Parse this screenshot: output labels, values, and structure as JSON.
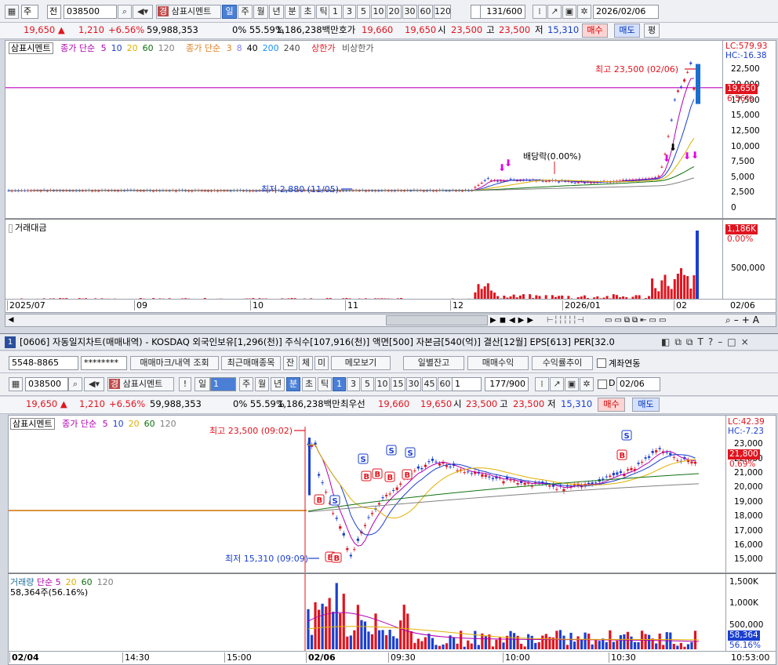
{
  "top": {
    "toolbar": {
      "mode1": "주",
      "mode2": "전",
      "code": "038500",
      "stock_badge": "경",
      "stock_name": "삼표시멘트",
      "periods": [
        "일",
        "주",
        "월",
        "년",
        "분",
        "초",
        "틱"
      ],
      "active_period": "일",
      "nums": [
        "1",
        "3",
        "5",
        "10",
        "20",
        "30",
        "60",
        "120"
      ],
      "count": "131",
      "count_max": "/600",
      "date": "2026/02/06"
    },
    "quote": {
      "price": "19,650 ▲",
      "change": "1,210",
      "rate": "+6.56%",
      "volume": "59,988,353",
      "pct": "0% 55.59%",
      "amount": "1,186,238백만",
      "hoga_label": "호가",
      "bid1": "19,660",
      "bid2": "19,650",
      "open_label": "시",
      "open": "23,500",
      "high_label": "고",
      "high": "23,500",
      "low_label": "저",
      "low": "15,310",
      "buy": "매수",
      "sell": "매도",
      "eval": "평"
    },
    "legend": {
      "name": "삼표시멘트",
      "ma1_label": "종가 단순",
      "ma1": [
        "5",
        "10",
        "20",
        "60",
        "120"
      ],
      "ma2_label": "종가 단순",
      "ma2": [
        "3",
        "8",
        "40",
        "200",
        "240"
      ],
      "upper": "상한가",
      "lower": "비상한가"
    },
    "price_axis": {
      "lc": "LC:579.93",
      "hc": "HC:-16.38",
      "ticks": [
        "22,500",
        "20,000",
        "17,500",
        "15,000",
        "12,500",
        "10,000",
        "7,500",
        "5,000",
        "2,500",
        "0"
      ],
      "cur": "19,650",
      "cur_pct": "6.56%"
    },
    "annotations": {
      "high": "최고 23,500 (02/06)",
      "low": "최저 2,880 (11/05)",
      "dividend": "배당락(0.00%)"
    },
    "volume_legend": "거래대금",
    "volume_axis": {
      "cur": "1,186K",
      "cur_pct": "0.00%",
      "tick": "500,000"
    },
    "x_labels": [
      "2025/07",
      "09",
      "10",
      "11",
      "12",
      "2026/01",
      "02"
    ],
    "x_right": "02/06"
  },
  "bottom": {
    "window": {
      "num": "1",
      "title": "[0606] 자동일지차트(매매내역) - KOSDAQ 외국인보유[1,296(천)] 주식수[107,916(천)] 액면[500] 자본금[540(억)] 결산[12월] EPS[613] PER[32.0",
      "ctrls": [
        "◧",
        "⧉",
        "⧉",
        "T",
        "?",
        "–",
        "□",
        "×"
      ]
    },
    "acct": {
      "account": "5548-8865",
      "password": "********",
      "btn_mark": "매매마크/내역 조회",
      "btn_recent": "최근매매종목",
      "btn_jan": "잔",
      "btn_che": "체",
      "btn_mi": "미",
      "btn_memo": "메모보기",
      "btn_daily": "일별잔고",
      "btn_profit": "매매수익",
      "btn_trend": "수익률추이",
      "chk_link": "계좌연동"
    },
    "toolbar": {
      "code": "038500",
      "stock_badge": "경",
      "stock_name": "삼표시멘트",
      "excl": "!",
      "period": "일",
      "period_num": "1",
      "periods": [
        "주",
        "월",
        "년",
        "분",
        "초",
        "틱"
      ],
      "active_period": "분",
      "nums": [
        "1",
        "3",
        "5",
        "10",
        "15",
        "30",
        "45",
        "60"
      ],
      "num_sel": "1",
      "count": "177",
      "count_max": "/900",
      "chk_d": "D",
      "date": "02/06"
    },
    "quote": {
      "price": "19,650 ▲",
      "change": "1,210",
      "rate": "+6.56%",
      "volume": "59,988,353",
      "pct": "0% 55.59%",
      "amount": "1,186,238백만",
      "hoga_label": "최우선",
      "bid1": "19,660",
      "bid2": "19,650",
      "open_label": "시",
      "open": "23,500",
      "high_label": "고",
      "high": "23,500",
      "low_label": "저",
      "low": "15,310",
      "buy": "매수",
      "sell": "매도"
    },
    "legend": {
      "name": "삼표시멘트",
      "ma_label": "종가 단순",
      "ma": [
        "5",
        "10",
        "20",
        "60",
        "120"
      ]
    },
    "price_axis": {
      "lc": "LC:42.39",
      "hc": "HC:-7.23",
      "ticks": [
        "23,000",
        "22,000",
        "21,000",
        "20,000",
        "19,000",
        "18,000",
        "17,000",
        "16,000",
        "15,000"
      ],
      "cur": "21,800",
      "cur_pct": "0.69%"
    },
    "annotations": {
      "high": "최고 23,500 (09:02)",
      "low": "최저 15,310 (09:09)"
    },
    "volume_legend": {
      "label": "거래량",
      "ma_label": "단순",
      "ma": [
        "5",
        "20",
        "60",
        "120"
      ],
      "value": "58,364주(56.16%)"
    },
    "volume_axis": {
      "ticks": [
        "1,500K",
        "1,000K",
        "500,000"
      ],
      "cur": "58,364",
      "cur_pct": "56.16%"
    },
    "x_labels": [
      "02/04",
      "14:30",
      "15:00",
      "02/06",
      "09:30",
      "10:00",
      "10:30"
    ],
    "x_right": "10:53:00"
  },
  "colors": {
    "up": "#e0141e",
    "down": "#1a3fd0",
    "accent": "#4b7fd6",
    "limit_line": "#c000c0"
  }
}
